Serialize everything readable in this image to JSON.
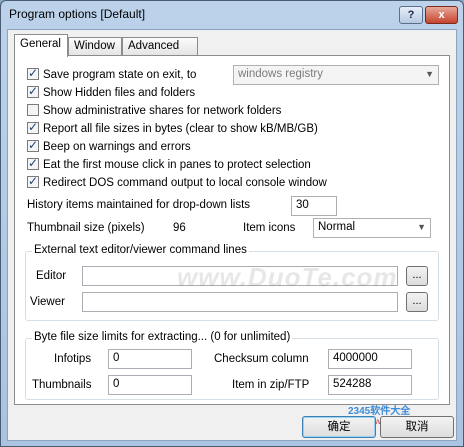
{
  "window": {
    "title": "Program options [Default]",
    "help_label": "?",
    "close_label": "x"
  },
  "tabs": [
    {
      "label": "General",
      "active": true
    },
    {
      "label": "Window",
      "active": false
    },
    {
      "label": "Advanced",
      "active": false
    }
  ],
  "checkboxes": [
    {
      "label": "Save program state on exit, to",
      "checked": true
    },
    {
      "label": "Show Hidden files and folders",
      "checked": true
    },
    {
      "label": "Show administrative shares for network folders",
      "checked": false
    },
    {
      "label": "Report all file sizes in bytes (clear to show kB/MB/GB)",
      "checked": true
    },
    {
      "label": "Beep on warnings and errors",
      "checked": true
    },
    {
      "label": "Eat the first mouse click in panes to protect selection",
      "checked": true
    },
    {
      "label": "Redirect DOS command output to local console window",
      "checked": true
    }
  ],
  "save_state_target": {
    "value": "windows registry"
  },
  "history": {
    "label": "History items maintained for drop-down lists",
    "value": "30"
  },
  "thumbnail": {
    "label": "Thumbnail size (pixels)",
    "value": "96"
  },
  "item_icons": {
    "label": "Item icons",
    "value": "Normal"
  },
  "external_editor": {
    "caption": "External text editor/viewer command lines",
    "editor_label": "Editor",
    "editor_value": "",
    "viewer_label": "Viewer",
    "viewer_value": "",
    "browse_label": "..."
  },
  "byte_limits": {
    "caption": "Byte file size limits for extracting... (0 for unlimited)",
    "infotips_label": "Infotips",
    "infotips_value": "0",
    "checksum_label": "Checksum column",
    "checksum_value": "4000000",
    "thumbnails_label": "Thumbnails",
    "thumbnails_value": "0",
    "zip_label": "Item in zip/FTP",
    "zip_value": "524288"
  },
  "watermark": {
    "text": "www.DuoTe.com"
  },
  "corner_logo": {
    "text": "2345软件大全",
    "url_text": "www.DuoTe.com"
  },
  "buttons": {
    "ok": "确定",
    "cancel": "取消"
  }
}
